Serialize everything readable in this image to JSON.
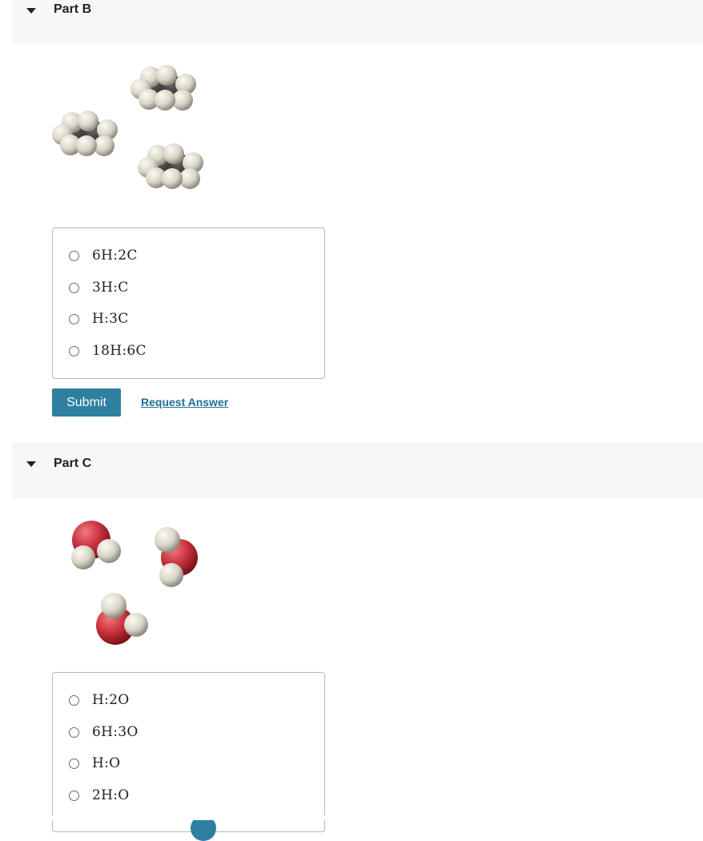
{
  "part_b": {
    "title": "Part B",
    "options": [
      "6H:2C",
      "3H:C",
      "H:3C",
      "18H:6C"
    ],
    "submit_label": "Submit",
    "request_label": "Request Answer"
  },
  "part_c": {
    "title": "Part C",
    "options": [
      "H:2O",
      "6H:3O",
      "H:O",
      "2H:O"
    ]
  },
  "colors": {
    "accent": "#2e7fa0",
    "link": "#1f6f94",
    "hydrogen": "#e6e2d6",
    "carbon": "#2b2b2b",
    "oxygen": "#c9323d"
  },
  "icons": {
    "toggle": "caret-down-icon",
    "radio": "radio-unchecked-icon"
  }
}
